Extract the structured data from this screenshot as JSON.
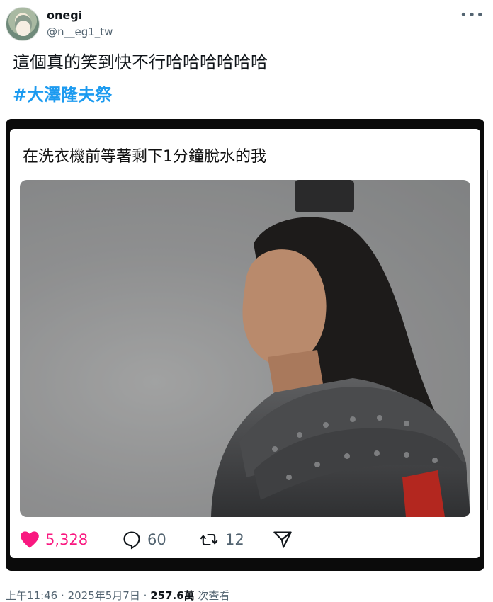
{
  "post": {
    "display_name": "onegi",
    "handle": "@n__eg1_tw",
    "text": "這個真的笑到快不行哈哈哈哈哈哈",
    "hashtag": "#大澤隆夫祭",
    "more_icon": "more-horizontal-icon"
  },
  "embed": {
    "caption": "在洗衣機前等著剩下1分鐘脫水的我",
    "image_description_icon": "photo",
    "likes": "5,328",
    "replies": "60",
    "reposts": "12",
    "icons": {
      "like": "heart-icon",
      "reply": "comment-icon",
      "repost": "repost-icon",
      "share": "share-icon"
    },
    "colors": {
      "like": "#f91880",
      "muted": "#536471"
    }
  },
  "meta": {
    "time": "上午11:46",
    "separator": "·",
    "date": "2025年5月7日",
    "views": "257.6萬",
    "views_label": "次查看"
  }
}
